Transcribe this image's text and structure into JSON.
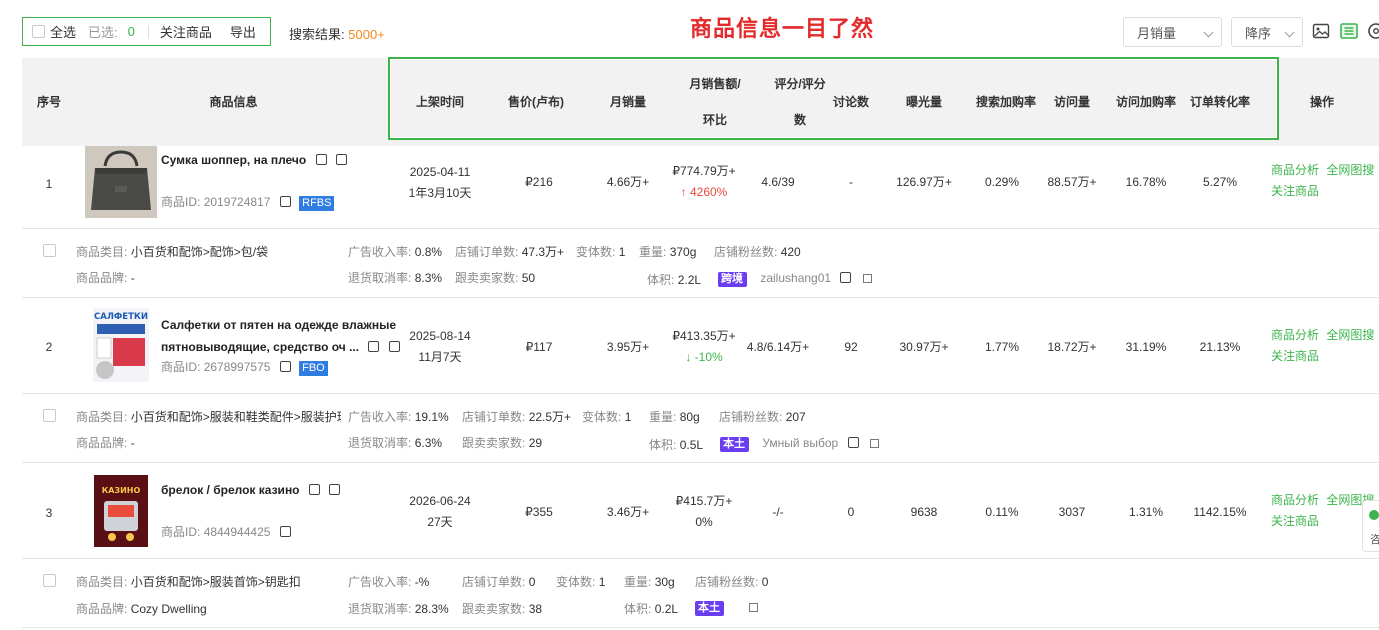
{
  "toolbar": {
    "select_all": "全选",
    "selected_label": "已选:",
    "selected_count": "0",
    "follow": "关注商品",
    "export": "导出",
    "search_result_label": "搜索结果:",
    "search_result_count": "5000+",
    "headline": "商品信息一目了然",
    "sort_field": "月销量",
    "sort_order": "降序"
  },
  "colors": {
    "accent": "#3cb44b",
    "headline": "#e32b2b",
    "up": "#e64a3b",
    "tag_blue": "#2f7de1",
    "market_purple": "#6a3ef0",
    "orange": "#f08a1c"
  },
  "icons": [
    "image-view-icon",
    "list-view-icon",
    "settings-icon",
    "copy-icon",
    "external-link-icon"
  ],
  "columns": {
    "index": "序号",
    "product": "商品信息",
    "listed": "上架时间",
    "price": "售价(卢布)",
    "monthly_sales": "月销量",
    "monthly_revenue_1": "月销售额/",
    "monthly_revenue_2": "环比",
    "rating_1": "评分/评分",
    "rating_2": "数",
    "discussions": "讨论数",
    "exposure": "曝光量",
    "search_cart_rate": "搜索加购率",
    "visits": "访问量",
    "visit_cart_rate": "访问加购率",
    "order_conv_rate": "订单转化率",
    "actions": "操作"
  },
  "detail_labels": {
    "category": "商品类目:",
    "brand": "商品品牌:",
    "ad_rate": "广告收入率:",
    "return_rate": "退货取消率:",
    "shop_orders": "店铺订单数:",
    "followers": "跟卖卖家数:",
    "variants": "变体数:",
    "weight": "重量:",
    "shop_fans": "店铺粉丝数:",
    "volume": "体积:"
  },
  "actions": {
    "analysis": "商品分析",
    "image_search": "全网图搜",
    "follow": "关注商品"
  },
  "side_tab": {
    "text": "咨"
  },
  "rows": [
    {
      "index": "1",
      "title": "Сумка шоппер, на плечо",
      "id_label": "商品ID:",
      "id": "2019724817",
      "tag": "RFBS",
      "listed_date": "2025-04-11",
      "listed_age": "1年3月10天",
      "price": "₽216",
      "monthly_sales": "4.66万+",
      "revenue": "₽774.79万+",
      "revenue_change": "↑ 4260%",
      "rating": "4.6/39",
      "discussions": "-",
      "exposure": "126.97万+",
      "search_cart_rate": "0.29%",
      "visits": "88.57万+",
      "visit_cart_rate": "16.78%",
      "order_conv_rate": "5.27%",
      "category": "小百货和配饰>配饰>包/袋",
      "brand": "-",
      "ad_rate": "0.8%",
      "return_rate": "8.3%",
      "shop_orders": "47.3万+",
      "followers": "50",
      "variants": "1",
      "weight": "370g",
      "shop_fans": "420",
      "volume": "2.2L",
      "market": "跨境",
      "shop": "zailushang01"
    },
    {
      "index": "2",
      "title_1": "Салфетки от пятен на одежде влажные",
      "title_2": "пятновыводящие, средство оч ...",
      "id_label": "商品ID:",
      "id": "2678997575",
      "tag": "FBO",
      "listed_date": "2025-08-14",
      "listed_age": "11月7天",
      "price": "₽117",
      "monthly_sales": "3.95万+",
      "revenue": "₽413.35万+",
      "revenue_change": "↓ -10%",
      "rating": "4.8/6.14万+",
      "discussions": "92",
      "exposure": "30.97万+",
      "search_cart_rate": "1.77%",
      "visits": "18.72万+",
      "visit_cart_rate": "31.19%",
      "order_conv_rate": "21.13%",
      "category": "小百货和配饰>服装和鞋类配件>服装护理产",
      "brand": "-",
      "ad_rate": "19.1%",
      "return_rate": "6.3%",
      "shop_orders": "22.5万+",
      "followers": "29",
      "variants": "1",
      "weight": "80g",
      "shop_fans": "207",
      "volume": "0.5L",
      "market": "本土",
      "shop": "Умный выбор",
      "thumb_text": "САЛФЕТКИ"
    },
    {
      "index": "3",
      "title": "брелок / брелок казино",
      "id_label": "商品ID:",
      "id": "4844944425",
      "listed_date": "2026-06-24",
      "listed_age": "27天",
      "price": "₽355",
      "monthly_sales": "3.46万+",
      "revenue": "₽415.7万+",
      "revenue_change": "0%",
      "rating": "-/-",
      "discussions": "0",
      "exposure": "9638",
      "search_cart_rate": "0.11%",
      "visits": "3037",
      "visit_cart_rate": "1.31%",
      "order_conv_rate": "1142.15%",
      "category": "小百货和配饰>服装首饰>钥匙扣",
      "brand": "Cozy Dwelling",
      "ad_rate": "-%",
      "return_rate": "28.3%",
      "shop_orders": "0",
      "followers": "38",
      "variants": "1",
      "weight": "30g",
      "shop_fans": "0",
      "volume": "0.2L",
      "market": "本土",
      "thumb_text": "КАЗИНО"
    }
  ]
}
